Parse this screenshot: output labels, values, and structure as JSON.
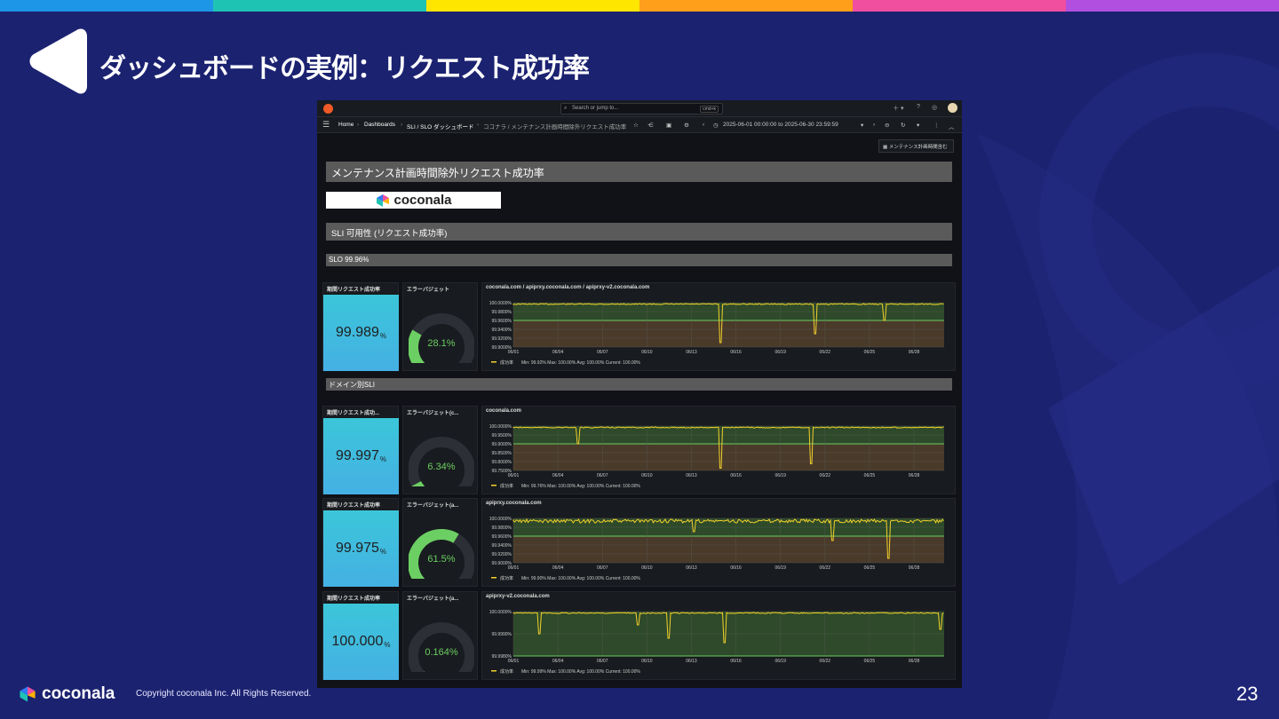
{
  "slide": {
    "title": "ダッシュボードの実例：リクエスト成功率",
    "footer_brand": "coconala",
    "copyright": "Copyright coconala Inc. All Rights Reserved.",
    "page_number": "23",
    "colors": {
      "background": "#1b2270",
      "rainbow": [
        "#1e96e8",
        "#1fc3b4",
        "#ffe600",
        "#ff9f1a",
        "#f04fa0",
        "#b14fe0"
      ]
    }
  },
  "grafana": {
    "search_placeholder": "Search or jump to...",
    "search_shortcut": "cmd+k",
    "breadcrumb": [
      "Home",
      "Dashboards",
      "SLI / SLO ダッシュボード",
      "ココナラ / メンテナンス計画時間除外リクエスト成功率"
    ],
    "time_range": "2025-06-01 00:00:00 to 2025-06-30 23:59:59",
    "variable_button": "メンテナンス計画時間含む",
    "dashboard_title": "メンテナンス計画時間除外リクエスト成功率",
    "banner_brand": "coconala",
    "row_sli": "SLI 可用性 (リクエスト成功率)",
    "row_slo": "SLO 99.96%",
    "row_domain": "ドメイン別SLI",
    "x_ticks": [
      "06/01",
      "06/04",
      "06/07",
      "06/10",
      "06/13",
      "06/16",
      "06/19",
      "06/22",
      "06/25",
      "06/28"
    ],
    "legend_name": "成功率",
    "rows": [
      {
        "stat_title": "期間リクエスト成功率",
        "stat_value": "99.989",
        "stat_unit": "%",
        "gauge_title": "エラーバジェット",
        "gauge_value": "28.1%",
        "gauge_fraction": 0.281,
        "chart_title": "coconala.com / apiprxy.coconala.com / apiprxy-v2.coconala.com",
        "y_ticks": [
          "100.0000%",
          "99.9800%",
          "99.9600%",
          "99.9400%",
          "99.9200%",
          "99.9000%"
        ],
        "legend_stats": "Min: 99.92%  Max: 100.00%  Avg: 100.00%  Current: 100.00%"
      },
      {
        "stat_title": "期間リクエスト成功...",
        "stat_value": "99.997",
        "stat_unit": "%",
        "gauge_title": "エラーバジェット(c...",
        "gauge_value": "6.34%",
        "gauge_fraction": 0.0634,
        "chart_title": "coconala.com",
        "y_ticks": [
          "100.0000%",
          "99.9500%",
          "99.9000%",
          "99.8500%",
          "99.8000%",
          "99.7500%"
        ],
        "legend_stats": "Min: 99.76%  Max: 100.00%  Avg: 100.00%  Current: 100.00%"
      },
      {
        "stat_title": "期間リクエスト成功率",
        "stat_value": "99.975",
        "stat_unit": "%",
        "gauge_title": "エラーバジェット(a...",
        "gauge_value": "61.5%",
        "gauge_fraction": 0.615,
        "chart_title": "apiprxy.coconala.com",
        "y_ticks": [
          "100.0000%",
          "99.9800%",
          "99.9600%",
          "99.9400%",
          "99.9200%",
          "99.9000%"
        ],
        "legend_stats": "Min: 99.90%  Max: 100.00%  Avg: 100.00%  Current: 100.00%"
      },
      {
        "stat_title": "期間リクエスト成功率",
        "stat_value": "100.000",
        "stat_unit": "%",
        "gauge_title": "エラーバジェット(a...",
        "gauge_value": "0.164%",
        "gauge_fraction": 0.00164,
        "chart_title": "apiprxy-v2.coconala.com",
        "y_ticks": [
          "100.0000%",
          "99.9990%",
          "99.9980%"
        ],
        "legend_stats": "Min: 99.99%  Max: 100.00%  Avg: 100.00%  Current: 100.00%"
      }
    ]
  }
}
